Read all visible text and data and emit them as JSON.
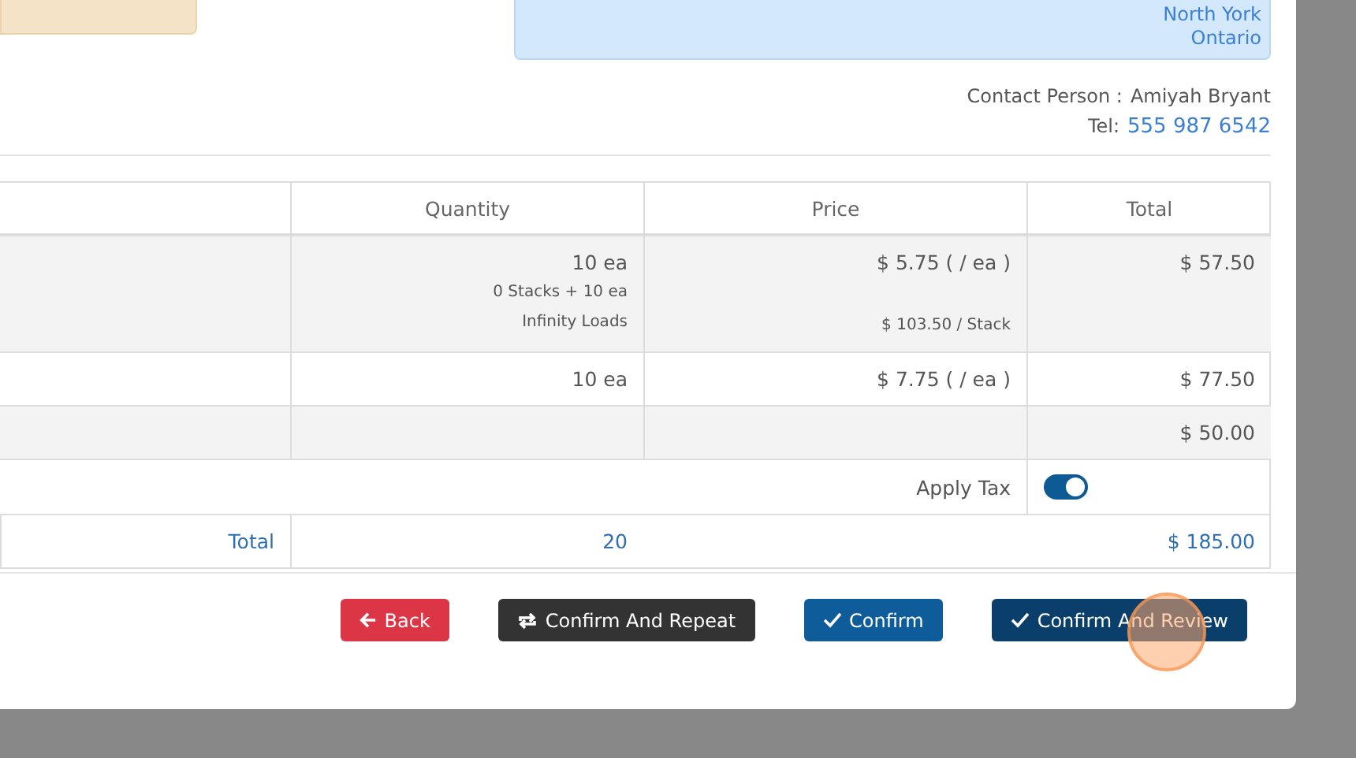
{
  "address": {
    "lines": [
      "North York",
      "Ontario"
    ]
  },
  "contact": {
    "label": "Contact Person :",
    "name": "Amiyah Bryant",
    "tel_label": "Tel:",
    "tel": "555 987 6542"
  },
  "table": {
    "columns": [
      "Quantity",
      "Price",
      "Total"
    ],
    "rows": [
      {
        "kind": "item",
        "quantity": "10 ea",
        "quantity_notes": [
          "0 Stacks + 10 ea",
          "Infinity Loads"
        ],
        "price": "$ 5.75 ( / ea )",
        "price_note": "$ 103.50 / Stack",
        "total": "$ 57.50"
      },
      {
        "kind": "item",
        "quantity": "10 ea",
        "price": "$ 7.75 ( / ea )",
        "total": "$ 77.50"
      },
      {
        "kind": "item",
        "total": "$ 50.00"
      },
      {
        "kind": "tax",
        "label": "Apply Tax",
        "on": true
      },
      {
        "kind": "total",
        "label": "Total",
        "quantity": "20",
        "total": "$ 185.00"
      }
    ]
  },
  "buttons": [
    {
      "kind": "back",
      "label": "Back"
    },
    {
      "kind": "repeat",
      "label": "Confirm And Repeat"
    },
    {
      "kind": "confirm",
      "label": "Confirm"
    },
    {
      "kind": "review",
      "label": "Confirm And Review"
    }
  ]
}
